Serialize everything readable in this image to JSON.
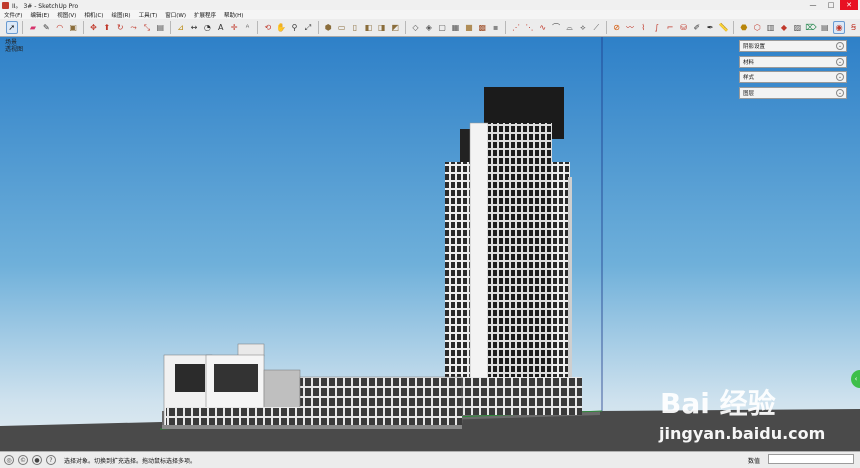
{
  "window": {
    "title": "II。 3# - SketchUp Pro",
    "controls": [
      "—",
      "□",
      "✕"
    ]
  },
  "menu": [
    "文件(F)",
    "编辑(E)",
    "视图(V)",
    "相机(C)",
    "绘图(R)",
    "工具(T)",
    "窗口(W)",
    "扩展程序",
    "帮助(H)"
  ],
  "viewport": {
    "scene_name": "场景",
    "camera": "透视图"
  },
  "trays": [
    {
      "label": "阴影设置"
    },
    {
      "label": "材料"
    },
    {
      "label": "样式"
    },
    {
      "label": "图层"
    }
  ],
  "watermark": {
    "brand": "Bai 经验",
    "url": "jingyan.baidu.com"
  },
  "status": {
    "message": "选择对象。切换到扩充选择。拖动鼠标选择多项。",
    "measure_label": "数值",
    "measure_value": ""
  },
  "colors": {
    "sky_top": "#2f80c9",
    "sky_bottom": "#dfe9f0",
    "ground": "#4f4f4f"
  }
}
